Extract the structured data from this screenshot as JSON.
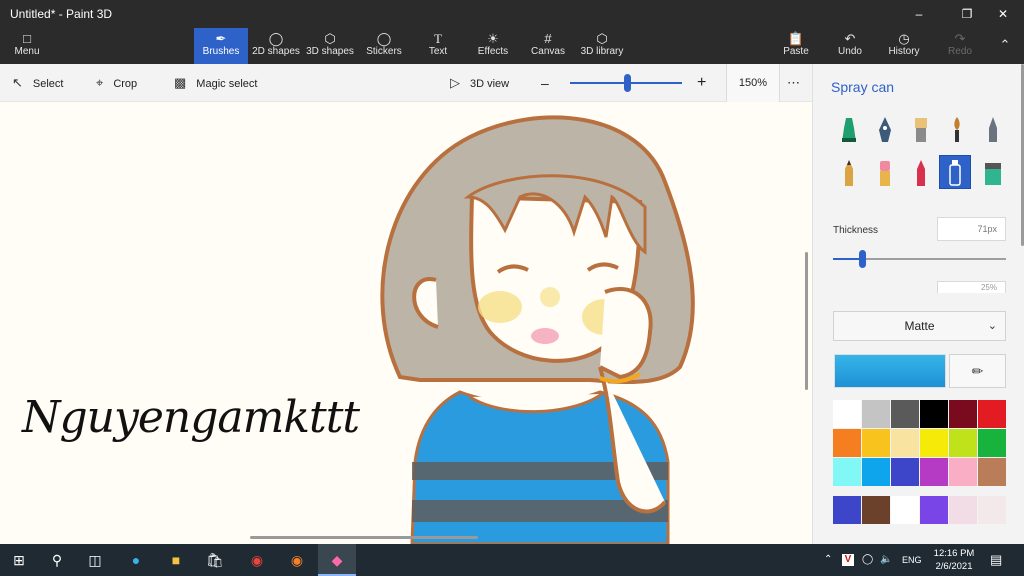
{
  "window": {
    "title": "Untitled* - Paint 3D"
  },
  "ribbon": {
    "menu": "Menu",
    "tools": [
      {
        "label": "Brushes",
        "icon": "brush-icon",
        "active": true
      },
      {
        "label": "2D shapes",
        "icon": "2d-shapes-icon"
      },
      {
        "label": "3D shapes",
        "icon": "3d-shapes-icon"
      },
      {
        "label": "Stickers",
        "icon": "stickers-icon"
      },
      {
        "label": "Text",
        "icon": "text-icon"
      },
      {
        "label": "Effects",
        "icon": "effects-icon"
      },
      {
        "label": "Canvas",
        "icon": "canvas-icon"
      },
      {
        "label": "3D library",
        "icon": "3d-library-icon"
      }
    ],
    "right": [
      {
        "label": "Paste",
        "icon": "paste-icon"
      },
      {
        "label": "Undo",
        "icon": "undo-icon"
      },
      {
        "label": "History",
        "icon": "history-icon"
      },
      {
        "label": "Redo",
        "icon": "redo-icon",
        "disabled": true
      }
    ]
  },
  "toolbar": {
    "select": "Select",
    "crop": "Crop",
    "magic_select": "Magic select",
    "view_3d": "3D view",
    "zoom": "150%",
    "zoom_level_fraction": 0.5
  },
  "canvas": {
    "signature": "Nguyengamkttt"
  },
  "panel": {
    "title": "Spray can",
    "brushes": [
      {
        "name": "marker",
        "color": "#1f9e6f"
      },
      {
        "name": "calligraphy-pen",
        "color": "#3c5a7a"
      },
      {
        "name": "oil-brush",
        "color": "#e9c27a"
      },
      {
        "name": "watercolor",
        "color": "#c27e2e"
      },
      {
        "name": "pixel-pen",
        "color": "#6b7280"
      },
      {
        "name": "pencil",
        "color": "#d9a441"
      },
      {
        "name": "eraser",
        "color": "#f08aa0"
      },
      {
        "name": "crayon",
        "color": "#d8314f"
      },
      {
        "name": "spray-can",
        "color": "#ffffff",
        "selected": true
      },
      {
        "name": "fill",
        "color": "#2fb58f"
      }
    ],
    "thickness_label": "Thickness",
    "thickness_value": "71px",
    "thickness_fraction": 0.17,
    "opacity_value": "25%",
    "finish": "Matte",
    "current_color": "#1e90d6",
    "palette": [
      "#ffffff",
      "#c4c4c4",
      "#5a5a5a",
      "#000000",
      "#7a0a1e",
      "#e31b23",
      "#f57f20",
      "#f9c31d",
      "#f9e3a1",
      "#f6ea08",
      "#c0e21a",
      "#17b33d",
      "#81f8f5",
      "#0ea5ec",
      "#3d46c9",
      "#b53bc4",
      "#f9aec5",
      "#b97d5a"
    ],
    "custom_palette": [
      "#3d46c9",
      "#6b412c",
      "#ffffff",
      "#7a45e6",
      "#f2dde6",
      "#f4e9ea"
    ]
  },
  "taskbar": {
    "apps": [
      "start-icon",
      "search-icon",
      "task-view-icon",
      "edge-icon",
      "file-explorer-icon",
      "store-icon",
      "chrome-icon",
      "firefox-icon",
      "paint3d-icon"
    ],
    "lang": "ENG",
    "time": "12:16 PM",
    "date": "2/6/2021"
  }
}
